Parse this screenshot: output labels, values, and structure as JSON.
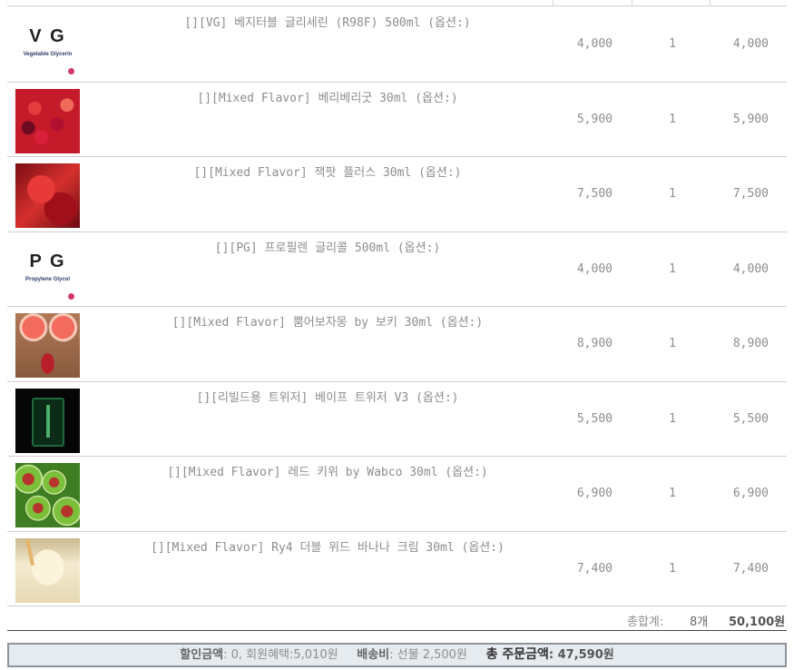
{
  "cart": {
    "items": [
      {
        "name": "[][VG] 베지터블 글리세린 (R98F) 500ml (옵션:)",
        "price": "4,000",
        "qty": "1",
        "amount": "4,000",
        "thumb_text": "V G",
        "thumb_sub": "Vegetable Glycerin"
      },
      {
        "name": "[][Mixed Flavor] 베리베리굿 30ml (옵션:)",
        "price": "5,900",
        "qty": "1",
        "amount": "5,900"
      },
      {
        "name": "[][Mixed Flavor] 잭팟 플러스 30ml (옵션:)",
        "price": "7,500",
        "qty": "1",
        "amount": "7,500"
      },
      {
        "name": "[][PG] 프로필렌 글리콜 500ml (옵션:)",
        "price": "4,000",
        "qty": "1",
        "amount": "4,000",
        "thumb_text": "P G",
        "thumb_sub": "Propylene Glycol"
      },
      {
        "name": "[][Mixed Flavor] 뿜어보자몽 by 보키 30ml (옵션:)",
        "price": "8,900",
        "qty": "1",
        "amount": "8,900"
      },
      {
        "name": "[][리빌드용 트위저] 베이프 트위저 V3 (옵션:)",
        "price": "5,500",
        "qty": "1",
        "amount": "5,500"
      },
      {
        "name": "[][Mixed Flavor] 레드 키위 by Wabco 30ml (옵션:)",
        "price": "6,900",
        "qty": "1",
        "amount": "6,900"
      },
      {
        "name": "[][Mixed Flavor] Ry4 더블 위드 바나나 크림 30ml (옵션:)",
        "price": "7,400",
        "qty": "1",
        "amount": "7,400"
      }
    ],
    "total": {
      "label": "총합계:",
      "count": "8개",
      "sum": "50,100원"
    }
  },
  "summary": {
    "discount_label": "할인금액",
    "discount_value": ": 0, 회원혜택:5,010원",
    "shipping_label": "배송비",
    "shipping_value": ": 선불 2,500원",
    "grand_label": "총 주문금액",
    "grand_value": ": 47,590원"
  }
}
